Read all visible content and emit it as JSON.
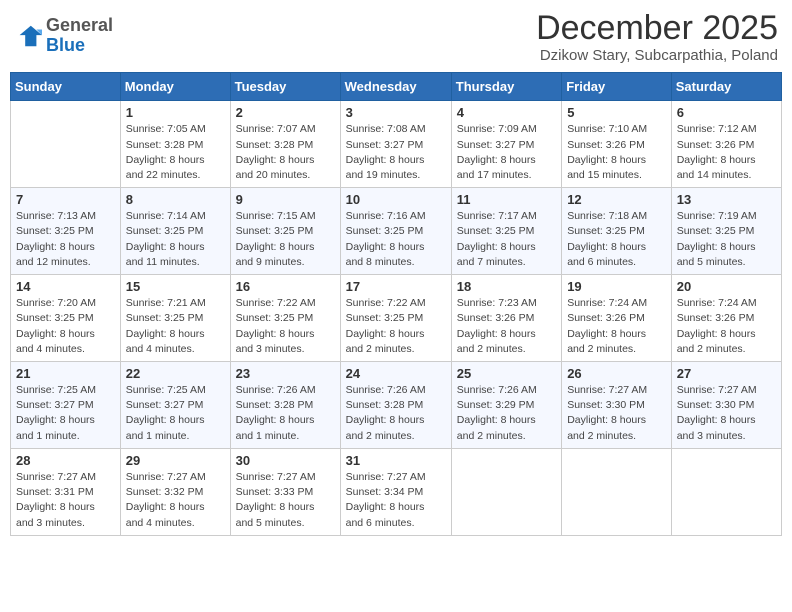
{
  "header": {
    "logo_general": "General",
    "logo_blue": "Blue",
    "month_year": "December 2025",
    "location": "Dzikow Stary, Subcarpathia, Poland"
  },
  "days_of_week": [
    "Sunday",
    "Monday",
    "Tuesday",
    "Wednesday",
    "Thursday",
    "Friday",
    "Saturday"
  ],
  "weeks": [
    [
      {
        "date": "",
        "info": ""
      },
      {
        "date": "1",
        "info": "Sunrise: 7:05 AM\nSunset: 3:28 PM\nDaylight: 8 hours\nand 22 minutes."
      },
      {
        "date": "2",
        "info": "Sunrise: 7:07 AM\nSunset: 3:28 PM\nDaylight: 8 hours\nand 20 minutes."
      },
      {
        "date": "3",
        "info": "Sunrise: 7:08 AM\nSunset: 3:27 PM\nDaylight: 8 hours\nand 19 minutes."
      },
      {
        "date": "4",
        "info": "Sunrise: 7:09 AM\nSunset: 3:27 PM\nDaylight: 8 hours\nand 17 minutes."
      },
      {
        "date": "5",
        "info": "Sunrise: 7:10 AM\nSunset: 3:26 PM\nDaylight: 8 hours\nand 15 minutes."
      },
      {
        "date": "6",
        "info": "Sunrise: 7:12 AM\nSunset: 3:26 PM\nDaylight: 8 hours\nand 14 minutes."
      }
    ],
    [
      {
        "date": "7",
        "info": "Sunrise: 7:13 AM\nSunset: 3:25 PM\nDaylight: 8 hours\nand 12 minutes."
      },
      {
        "date": "8",
        "info": "Sunrise: 7:14 AM\nSunset: 3:25 PM\nDaylight: 8 hours\nand 11 minutes."
      },
      {
        "date": "9",
        "info": "Sunrise: 7:15 AM\nSunset: 3:25 PM\nDaylight: 8 hours\nand 9 minutes."
      },
      {
        "date": "10",
        "info": "Sunrise: 7:16 AM\nSunset: 3:25 PM\nDaylight: 8 hours\nand 8 minutes."
      },
      {
        "date": "11",
        "info": "Sunrise: 7:17 AM\nSunset: 3:25 PM\nDaylight: 8 hours\nand 7 minutes."
      },
      {
        "date": "12",
        "info": "Sunrise: 7:18 AM\nSunset: 3:25 PM\nDaylight: 8 hours\nand 6 minutes."
      },
      {
        "date": "13",
        "info": "Sunrise: 7:19 AM\nSunset: 3:25 PM\nDaylight: 8 hours\nand 5 minutes."
      }
    ],
    [
      {
        "date": "14",
        "info": "Sunrise: 7:20 AM\nSunset: 3:25 PM\nDaylight: 8 hours\nand 4 minutes."
      },
      {
        "date": "15",
        "info": "Sunrise: 7:21 AM\nSunset: 3:25 PM\nDaylight: 8 hours\nand 4 minutes."
      },
      {
        "date": "16",
        "info": "Sunrise: 7:22 AM\nSunset: 3:25 PM\nDaylight: 8 hours\nand 3 minutes."
      },
      {
        "date": "17",
        "info": "Sunrise: 7:22 AM\nSunset: 3:25 PM\nDaylight: 8 hours\nand 2 minutes."
      },
      {
        "date": "18",
        "info": "Sunrise: 7:23 AM\nSunset: 3:26 PM\nDaylight: 8 hours\nand 2 minutes."
      },
      {
        "date": "19",
        "info": "Sunrise: 7:24 AM\nSunset: 3:26 PM\nDaylight: 8 hours\nand 2 minutes."
      },
      {
        "date": "20",
        "info": "Sunrise: 7:24 AM\nSunset: 3:26 PM\nDaylight: 8 hours\nand 2 minutes."
      }
    ],
    [
      {
        "date": "21",
        "info": "Sunrise: 7:25 AM\nSunset: 3:27 PM\nDaylight: 8 hours\nand 1 minute."
      },
      {
        "date": "22",
        "info": "Sunrise: 7:25 AM\nSunset: 3:27 PM\nDaylight: 8 hours\nand 1 minute."
      },
      {
        "date": "23",
        "info": "Sunrise: 7:26 AM\nSunset: 3:28 PM\nDaylight: 8 hours\nand 1 minute."
      },
      {
        "date": "24",
        "info": "Sunrise: 7:26 AM\nSunset: 3:28 PM\nDaylight: 8 hours\nand 2 minutes."
      },
      {
        "date": "25",
        "info": "Sunrise: 7:26 AM\nSunset: 3:29 PM\nDaylight: 8 hours\nand 2 minutes."
      },
      {
        "date": "26",
        "info": "Sunrise: 7:27 AM\nSunset: 3:30 PM\nDaylight: 8 hours\nand 2 minutes."
      },
      {
        "date": "27",
        "info": "Sunrise: 7:27 AM\nSunset: 3:30 PM\nDaylight: 8 hours\nand 3 minutes."
      }
    ],
    [
      {
        "date": "28",
        "info": "Sunrise: 7:27 AM\nSunset: 3:31 PM\nDaylight: 8 hours\nand 3 minutes."
      },
      {
        "date": "29",
        "info": "Sunrise: 7:27 AM\nSunset: 3:32 PM\nDaylight: 8 hours\nand 4 minutes."
      },
      {
        "date": "30",
        "info": "Sunrise: 7:27 AM\nSunset: 3:33 PM\nDaylight: 8 hours\nand 5 minutes."
      },
      {
        "date": "31",
        "info": "Sunrise: 7:27 AM\nSunset: 3:34 PM\nDaylight: 8 hours\nand 6 minutes."
      },
      {
        "date": "",
        "info": ""
      },
      {
        "date": "",
        "info": ""
      },
      {
        "date": "",
        "info": ""
      }
    ]
  ]
}
